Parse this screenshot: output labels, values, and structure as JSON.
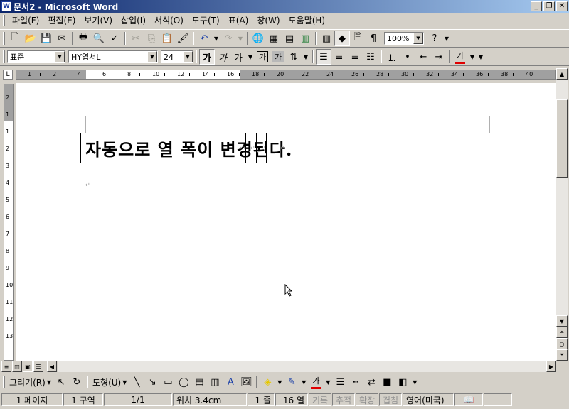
{
  "window": {
    "title": "문서2 - Microsoft Word",
    "app_icon": "W"
  },
  "menu": [
    "파일(F)",
    "편집(E)",
    "보기(V)",
    "삽입(I)",
    "서식(O)",
    "도구(T)",
    "표(A)",
    "창(W)",
    "도움말(H)"
  ],
  "standard_toolbar": {
    "zoom": "100%",
    "help_glyph": "?"
  },
  "format_toolbar": {
    "style": "표준",
    "font": "HY엽서L",
    "size": "24",
    "bold": "가",
    "italic": "가",
    "underline": "가",
    "char_border": "가",
    "char_shading": "가",
    "font_color_glyph": "가"
  },
  "ruler": {
    "h_numbers": [
      "1",
      "2",
      "4",
      "6",
      "8",
      "10",
      "12",
      "14",
      "16",
      "18",
      "20",
      "22",
      "24",
      "26",
      "28",
      "30",
      "32",
      "34",
      "36",
      "38",
      "40"
    ],
    "v_numbers": [
      "2",
      "1",
      "1",
      "2",
      "3",
      "4",
      "5",
      "6",
      "7",
      "8",
      "9",
      "10",
      "11",
      "12",
      "13"
    ]
  },
  "document": {
    "cell_text": "자동으로 열 폭이 변경된다.",
    "cell_mark": "↵",
    "para_mark": "↵"
  },
  "drawing_toolbar": {
    "draw": "그리기(R)",
    "autoshapes": "도형(U)",
    "font_color_glyph": "가"
  },
  "status": {
    "page": "1 페이지",
    "section": "1 구역",
    "pages": "1/1",
    "position": "위치 3.4cm",
    "line": "1 줄",
    "column": "16 열",
    "rec": "기록",
    "trk": "추적",
    "ext": "확장",
    "ovr": "겹침",
    "language": "영어(미국)"
  },
  "icons": [
    "new-icon",
    "open-icon",
    "save-icon",
    "print-icon",
    "print-preview-icon",
    "spelling-icon",
    "cut-icon",
    "copy-icon",
    "paste-icon",
    "format-painter-icon",
    "undo-icon",
    "redo-icon",
    "hyperlink-icon",
    "tables-borders-icon",
    "insert-table-icon",
    "insert-excel-icon",
    "columns-icon",
    "drawing-icon",
    "document-map-icon",
    "show-hide-icon",
    "help-icon"
  ]
}
